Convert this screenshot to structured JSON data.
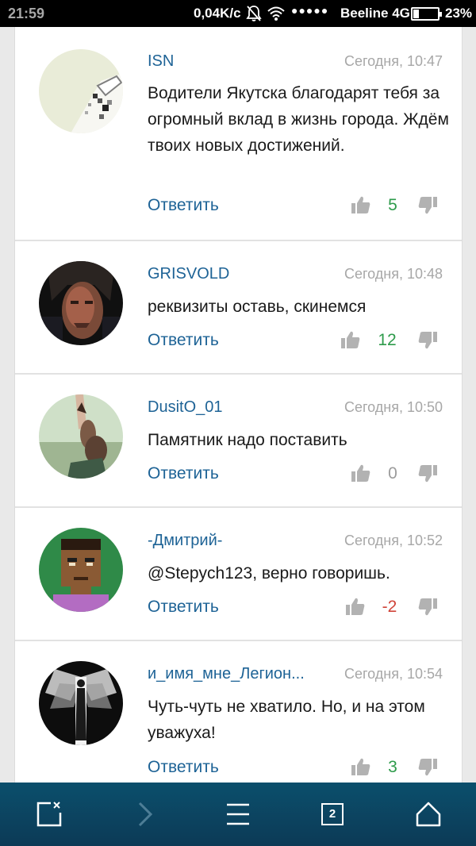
{
  "status_bar": {
    "time": "21:59",
    "speed": "0,04K/c",
    "signal": "●●●●●",
    "carrier": "Beeline 4G",
    "battery": "23%",
    "battery_level": 0.23
  },
  "comments": [
    {
      "author": "ISN",
      "time": "Сегодня, 10:47",
      "text": "Водители Якутска благодарят тебя за огромный вклад в жизнь города. Ждём твоих новых достижений.",
      "reply": "Ответить",
      "score": "5",
      "score_class": "pos",
      "avatar": "isn-avatar"
    },
    {
      "author": "GRISVOLD",
      "time": "Сегодня, 10:48",
      "text": "реквизиты оставь, скинемся",
      "reply": "Ответить",
      "score": "12",
      "score_class": "pos",
      "avatar": "grisvold-avatar"
    },
    {
      "author": "DusitO_01",
      "time": "Сегодня, 10:50",
      "text": "Памятник надо поставить",
      "reply": "Ответить",
      "score": "0",
      "score_class": "zero",
      "avatar": "dusito-avatar"
    },
    {
      "author": "-Дмитрий-",
      "time": "Сегодня, 10:52",
      "text": "@Stepych123, верно говоришь.",
      "reply": "Ответить",
      "score": "-2",
      "score_class": "neg",
      "avatar": "dmitriy-avatar"
    },
    {
      "author": "и_имя_мне_Легион...",
      "time": "Сегодня, 10:54",
      "text": "Чуть-чуть не хватило. Но, и на этом уважуха!",
      "reply": "Ответить",
      "score": "3",
      "score_class": "pos",
      "avatar": "legion-avatar"
    }
  ],
  "nav_bar": {
    "tab_count": "2",
    "icons": [
      "close-tab-icon",
      "forward-arrow-icon",
      "menu-icon",
      "tabs-icon",
      "home-icon"
    ]
  },
  "colors": {
    "author": "#1e6396",
    "score_positive": "#2e9b4b",
    "score_negative": "#d0453a",
    "score_zero": "#9c9c9c",
    "nav_background": "#0c3a56"
  }
}
